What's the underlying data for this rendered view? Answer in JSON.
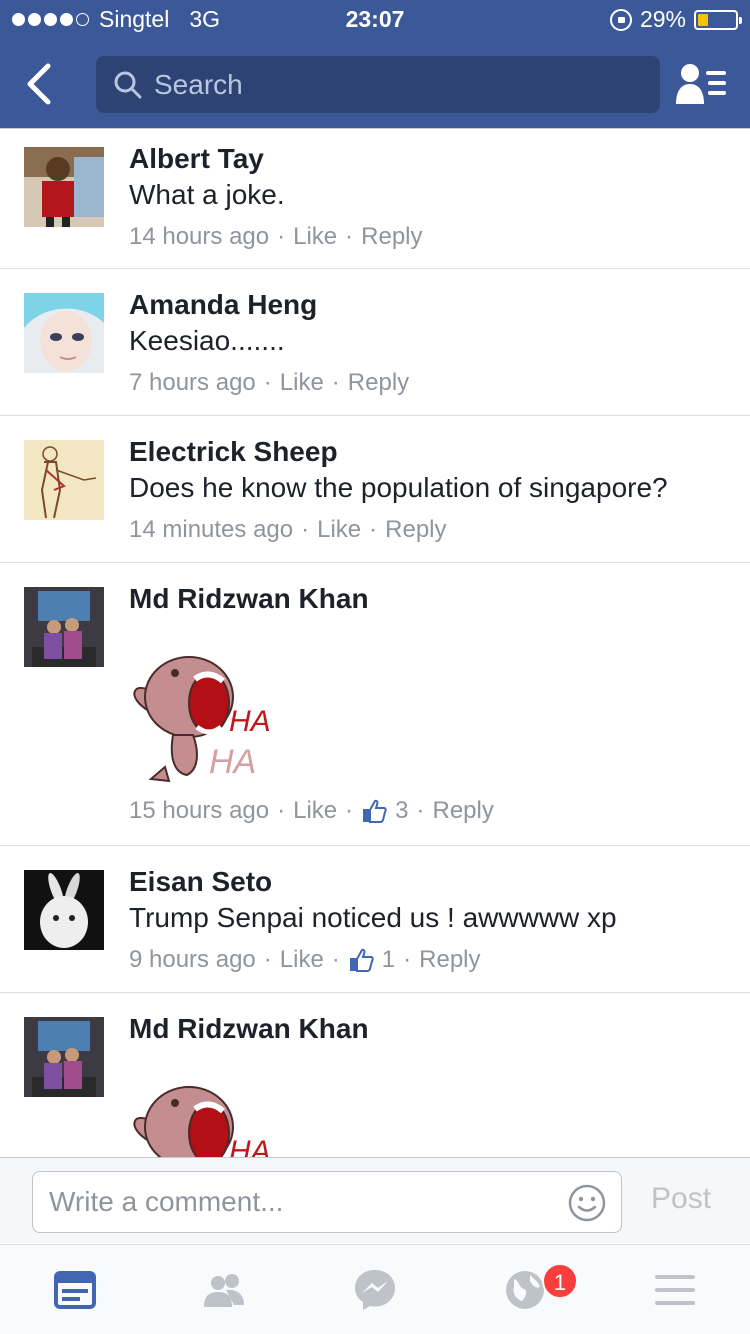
{
  "status_bar": {
    "carrier": "Singtel",
    "network": "3G",
    "time": "23:07",
    "battery_percent": "29%",
    "battery_level": 0.29,
    "signal_bars": 4
  },
  "header": {
    "search_placeholder": "Search",
    "back_icon": "chevron-left-icon",
    "friends_icon": "friends-list-icon"
  },
  "comments": [
    {
      "name": "Albert Tay",
      "text": "What a joke.",
      "time": "14 hours ago",
      "like": "Like",
      "reply": "Reply",
      "likes": ""
    },
    {
      "name": "Amanda Heng",
      "text": "Keesiao.......",
      "time": "7 hours ago",
      "like": "Like",
      "reply": "Reply",
      "likes": ""
    },
    {
      "name": "Electrick Sheep",
      "text": "Does he know the population of singapore?",
      "time": "14 minutes ago",
      "like": "Like",
      "reply": "Reply",
      "likes": ""
    },
    {
      "name": "Md Ridzwan Khan",
      "text": "",
      "sticker": "laughing-dog-sticker",
      "time": "15 hours ago",
      "like": "Like",
      "reply": "Reply",
      "likes": "3"
    },
    {
      "name": "Eisan Seto",
      "text": "Trump Senpai noticed us ! awwwww xp",
      "time": "9 hours ago",
      "like": "Like",
      "reply": "Reply",
      "likes": "1"
    },
    {
      "name": "Md Ridzwan Khan",
      "text": "",
      "sticker": "laughing-dog-sticker"
    }
  ],
  "sticker_text": {
    "line1": "HA",
    "line2": "HA"
  },
  "composer": {
    "placeholder": "Write a comment...",
    "post_label": "Post",
    "emoji_icon": "smiley-icon"
  },
  "tabbar": {
    "tabs": [
      "news-feed-icon",
      "friends-icon",
      "messenger-icon",
      "notifications-globe-icon",
      "menu-icon"
    ],
    "notification_badge": "1"
  },
  "colors": {
    "header_blue": "#3b5998",
    "search_bg": "#2d4373",
    "meta_gray": "#90949c",
    "active_tab": "#4267b2",
    "badge_red": "#fa3e3e"
  }
}
